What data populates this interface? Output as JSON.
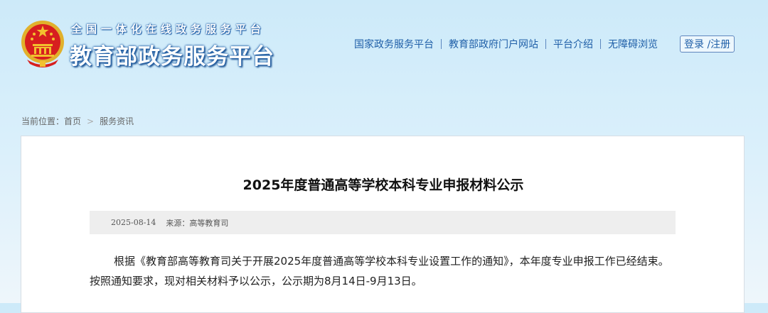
{
  "header": {
    "subtitle": "全国一体化在线政务服务平台",
    "title": "教育部政务服务平台",
    "nav": [
      {
        "label": "国家政务服务平台"
      },
      {
        "label": "教育部政府门户网站"
      },
      {
        "label": "平台介绍"
      },
      {
        "label": "无障碍浏览"
      }
    ],
    "login_label": "登录 /注册"
  },
  "breadcrumb": {
    "prefix": "当前位置：",
    "home": "首页",
    "current": "服务资讯"
  },
  "article": {
    "title": "2025年度普通高等学校本科专业申报材料公示",
    "date": "2025-08-14",
    "source": "来源：高等教育司",
    "body": "根据《教育部高等教育司关于开展2025年度普通高等学校本科专业设置工作的通知》，本年度专业申报工作已经结束。按照通知要求，现对相关材料予以公示，公示期为8月14日-9月13日。"
  },
  "colors": {
    "link": "#1f5fa8",
    "emblem_red": "#d71f1f",
    "emblem_gold": "#f2c12e"
  },
  "icons": {
    "emblem": "national-emblem-icon",
    "breadcrumb_separator": "chevron-right-icon"
  }
}
